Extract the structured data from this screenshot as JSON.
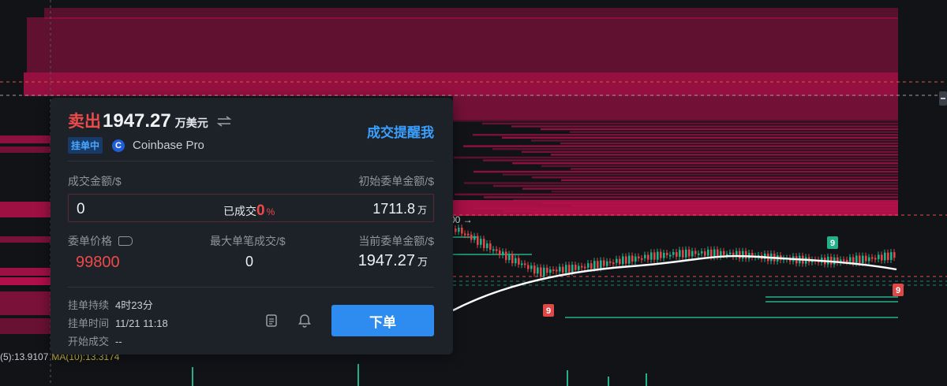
{
  "chart": {
    "price_label": "00 →",
    "ma5_label": "(5):13.9107",
    "ma10_label": "MA(10):13.3174",
    "markers": [
      "9",
      "9",
      "9"
    ],
    "colors": {
      "ask_wall": "#c2104e",
      "buy_line": "#1f8a6c",
      "up": "#23b08a",
      "down": "#e04848",
      "ma": "#ffffff"
    }
  },
  "order": {
    "side": "卖出",
    "amount": "1947.27",
    "unit": "万美元",
    "notify_label": "成交提醒我",
    "status_badge": "挂单中",
    "exchange_logo": "C",
    "exchange": "Coinbase Pro",
    "filled_label": "成交金额/$",
    "initial_label": "初始委单金额/$",
    "filled_value": "0",
    "filled_text": "已成交",
    "filled_pct": "0",
    "filled_pct_sign": "%",
    "initial_value": "1711.8",
    "initial_unit": "万",
    "price_label": "委单价格",
    "max_fill_label": "最大单笔成交/$",
    "current_label": "当前委单金额/$",
    "price_value": "99800",
    "max_fill_value": "0",
    "current_value": "1947.27",
    "current_unit": "万",
    "duration_label": "挂单持续",
    "duration_value": "4时23分",
    "time_label": "挂单时间",
    "time_value": "11/21 11:18",
    "start_label": "开始成交",
    "start_value": "--",
    "submit_label": "下单"
  }
}
